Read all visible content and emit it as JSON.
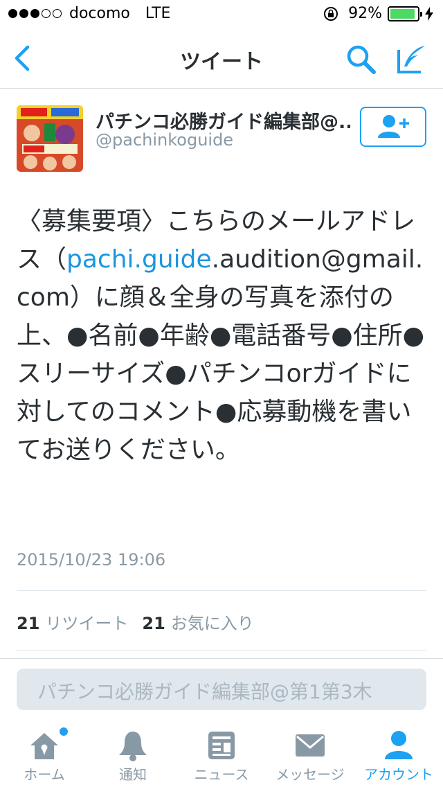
{
  "status_bar": {
    "carrier": "docomo",
    "network": "LTE",
    "signal_bars": 3,
    "signal_total": 5,
    "battery_percent_text": "92%",
    "battery_level": 0.92
  },
  "nav": {
    "title": "ツイート",
    "back_icon": "chevron-left-icon",
    "search_icon": "search-icon",
    "compose_icon": "compose-tweet-icon"
  },
  "tweet": {
    "user_name": "パチンコ必勝ガイド編集部@...",
    "user_handle": "@pachinkoguide",
    "text_before_link": "〈募集要項〉こちらのメールアドレス（",
    "link_text": "pachi.guide",
    "text_after_link": ".audition@gmail.com）に顔＆全身の写真を添付の上、●名前●年齢●電話番号●住所●スリーサイズ●パチンコorガイドに対してのコメント●応募動機を書いてお送りください。",
    "timestamp": "2015/10/23 19:06",
    "retweet_count": "21",
    "retweet_label": "リツイート",
    "favorite_count": "21",
    "favorite_label": "お気に入り"
  },
  "reply": {
    "placeholder": "パチンコ必勝ガイド編集部@第1第3木"
  },
  "tabs": [
    {
      "label": "ホーム",
      "icon": "home-icon",
      "active": false
    },
    {
      "label": "通知",
      "icon": "bell-icon",
      "active": false
    },
    {
      "label": "ニュース",
      "icon": "news-icon",
      "active": false
    },
    {
      "label": "メッセージ",
      "icon": "envelope-icon",
      "active": false
    },
    {
      "label": "アカウント",
      "icon": "person-icon",
      "active": true
    }
  ],
  "colors": {
    "accent": "#1da1f2",
    "link": "#1b95e0",
    "text": "#292f33",
    "muted": "#8899a6",
    "battery": "#4cd964"
  }
}
